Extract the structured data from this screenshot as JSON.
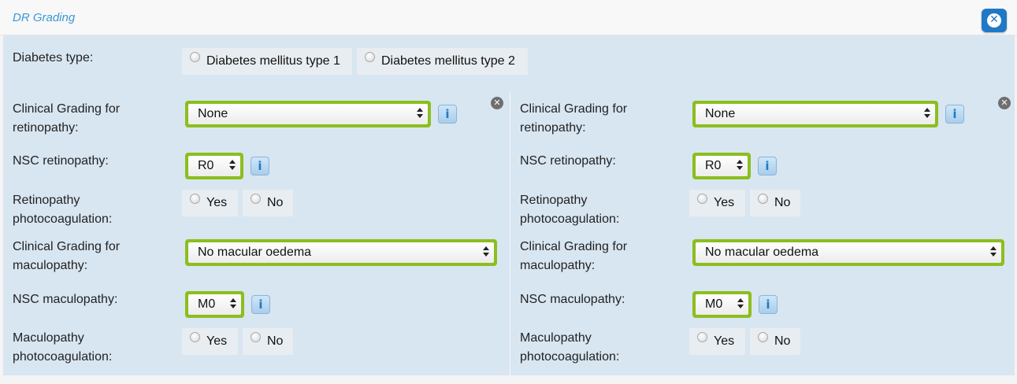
{
  "header": {
    "title": "DR Grading",
    "close_icon": "close-circle-icon"
  },
  "diabetes": {
    "label": "Diabetes type:",
    "options": [
      "Diabetes mellitus type 1",
      "Diabetes mellitus type 2"
    ]
  },
  "colors": {
    "select_border": "#8cbe1e",
    "panel_bg": "#d8e6f1",
    "accent": "#1f79c6"
  },
  "sides": [
    {
      "clinical_retinopathy_label": "Clinical Grading for",
      "clinical_retinopathy_label2": "retinopathy:",
      "clinical_retinopathy_value": "None",
      "nsc_retinopathy_label": "NSC retinopathy:",
      "nsc_retinopathy_value": "R0",
      "retino_photo_label": "Retinopathy",
      "retino_photo_label2": "photocoagulation:",
      "clinical_maculopathy_label": "Clinical Grading for",
      "clinical_maculopathy_label2": "maculopathy:",
      "clinical_maculopathy_value": "No macular oedema",
      "nsc_maculopathy_label": "NSC maculopathy:",
      "nsc_maculopathy_value": "M0",
      "macu_photo_label": "Maculopathy",
      "macu_photo_label2": "photocoagulation:",
      "yes": "Yes",
      "no": "No",
      "info": "i",
      "remove": "✕"
    },
    {
      "clinical_retinopathy_label": "Clinical Grading for",
      "clinical_retinopathy_label2": "retinopathy:",
      "clinical_retinopathy_value": "None",
      "nsc_retinopathy_label": "NSC retinopathy:",
      "nsc_retinopathy_value": "R0",
      "retino_photo_label": "Retinopathy",
      "retino_photo_label2": "photocoagulation:",
      "clinical_maculopathy_label": "Clinical Grading for",
      "clinical_maculopathy_label2": "maculopathy:",
      "clinical_maculopathy_value": "No macular oedema",
      "nsc_maculopathy_label": "NSC maculopathy:",
      "nsc_maculopathy_value": "M0",
      "macu_photo_label": "Maculopathy",
      "macu_photo_label2": "photocoagulation:",
      "yes": "Yes",
      "no": "No",
      "info": "i",
      "remove": "✕"
    }
  ]
}
